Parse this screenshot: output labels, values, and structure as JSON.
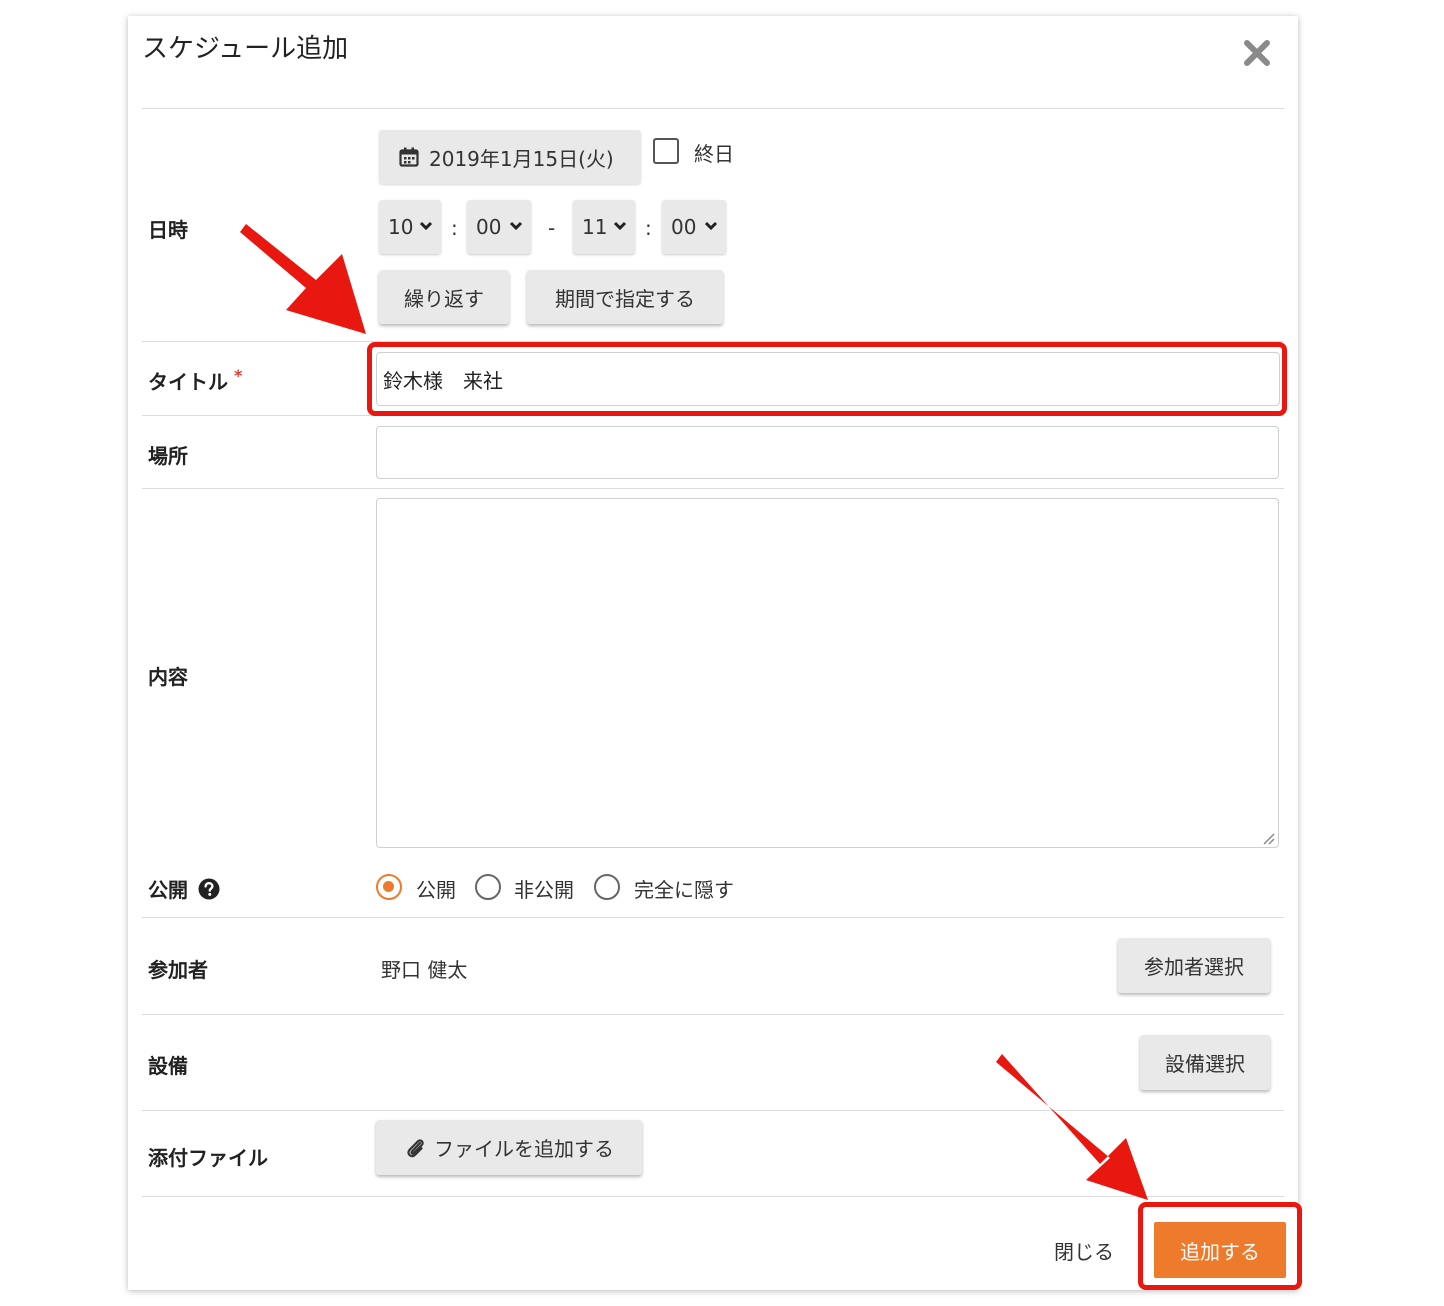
{
  "dialog": {
    "title": "スケジュール追加",
    "close_icon": "close-icon"
  },
  "datetime": {
    "label": "日時",
    "date": "2019年1月15日(火)",
    "date_icon": "calendar-icon",
    "allday_label": "終日",
    "allday_checked": false,
    "start_hour": "10",
    "start_minute": "00",
    "end_hour": "11",
    "end_minute": "00",
    "time_sep": ":",
    "range_sep": "-",
    "repeat_button": "繰り返す",
    "period_button": "期間で指定する"
  },
  "title_field": {
    "label": "タイトル",
    "required_mark": "*",
    "value": "鈴木様　来社"
  },
  "place_field": {
    "label": "場所",
    "value": ""
  },
  "content_field": {
    "label": "内容",
    "value": ""
  },
  "visibility": {
    "label": "公開",
    "help_icon": "question-circle-icon",
    "options": [
      {
        "label": "公開",
        "checked": true
      },
      {
        "label": "非公開",
        "checked": false
      },
      {
        "label": "完全に隠す",
        "checked": false
      }
    ]
  },
  "participants": {
    "label": "参加者",
    "value": "野口 健太",
    "select_button": "参加者選択"
  },
  "equipment": {
    "label": "設備",
    "select_button": "設備選択"
  },
  "attachment": {
    "label": "添付ファイル",
    "add_button": "ファイルを追加する",
    "icon": "paperclip-icon"
  },
  "footer": {
    "close_label": "閉じる",
    "submit_label": "追加する"
  },
  "colors": {
    "accent": "#ee7a2c",
    "annotation_red": "#e8170f",
    "required": "#e83b2e"
  }
}
